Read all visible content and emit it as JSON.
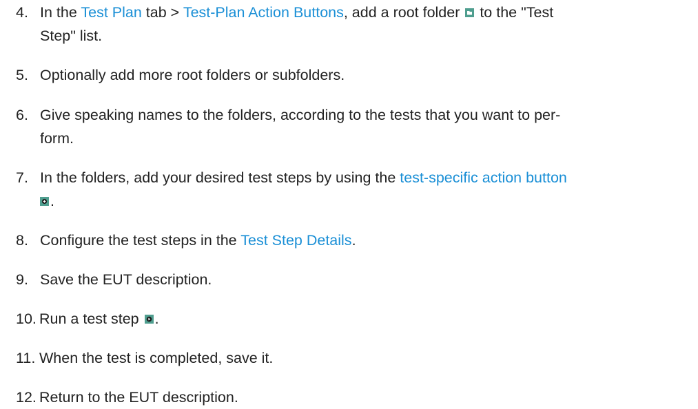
{
  "steps": [
    {
      "number": "4.",
      "parts": {
        "a": "In the ",
        "link1": "Test Plan",
        "b": " tab > ",
        "link2": "Test-Plan Action Buttons",
        "c": ", add a root folder ",
        "d": " to the \"Test",
        "line2": "Step\" list."
      },
      "icon": "root-folder-icon"
    },
    {
      "number": "5.",
      "text": "Optionally add more root folders or subfolders."
    },
    {
      "number": "6.",
      "line1": "Give speaking names to the folders, according to the tests that you want to per-",
      "line2": "form."
    },
    {
      "number": "7.",
      "parts": {
        "a": "In the folders, add your desired test steps by using the ",
        "link1": "test-specific action button",
        "end": "."
      },
      "icon": "add-test-step-icon"
    },
    {
      "number": "8.",
      "parts": {
        "a": "Configure the test steps in the ",
        "link1": "Test Step Details",
        "b": "."
      }
    },
    {
      "number": "9.",
      "text": "Save the EUT description."
    },
    {
      "number": "10.",
      "parts": {
        "a": "Run a test step ",
        "b": "."
      },
      "icon": "run-test-step-icon"
    },
    {
      "number": "11.",
      "text": "When the test is completed, save it."
    },
    {
      "number": "12.",
      "text": "Return to the EUT description."
    }
  ],
  "colors": {
    "text": "#222222",
    "link": "#1a8fd6",
    "icon": "#4f9e8f"
  }
}
